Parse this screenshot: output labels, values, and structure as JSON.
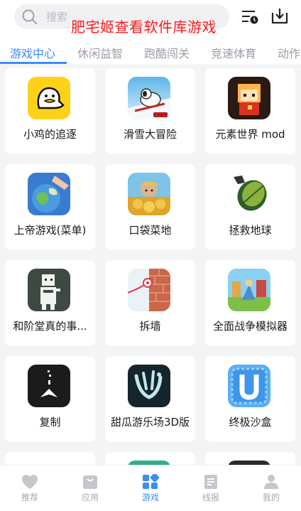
{
  "search": {
    "placeholder": "搜索"
  },
  "overlay_text": "肥宅姬查看软件库游戏",
  "tabs": [
    "游戏中心",
    "休闲益智",
    "跑酷闯关",
    "竞速体育",
    "动作"
  ],
  "active_tab": 0,
  "apps": [
    {
      "name": "小鸡的追逐"
    },
    {
      "name": "滑雪大冒险"
    },
    {
      "name": "元素世界 mod"
    },
    {
      "name": "上帝游戏(菜单)"
    },
    {
      "name": "口袋菜地"
    },
    {
      "name": "拯救地球"
    },
    {
      "name": "和阶堂真的事..."
    },
    {
      "name": "拆墙"
    },
    {
      "name": "全面战争模拟器"
    },
    {
      "name": "复制"
    },
    {
      "name": "甜瓜游乐场3D版"
    },
    {
      "name": "终极沙盒"
    }
  ],
  "bottom_nav": [
    {
      "label": "推荐",
      "icon": "heart-icon"
    },
    {
      "label": "应用",
      "icon": "bag-icon"
    },
    {
      "label": "游戏",
      "icon": "grid-icon"
    },
    {
      "label": "线报",
      "icon": "news-icon"
    },
    {
      "label": "我的",
      "icon": "person-icon"
    }
  ],
  "colors": {
    "accent": "#3b8df5",
    "overlay": "#ff1a1a"
  }
}
